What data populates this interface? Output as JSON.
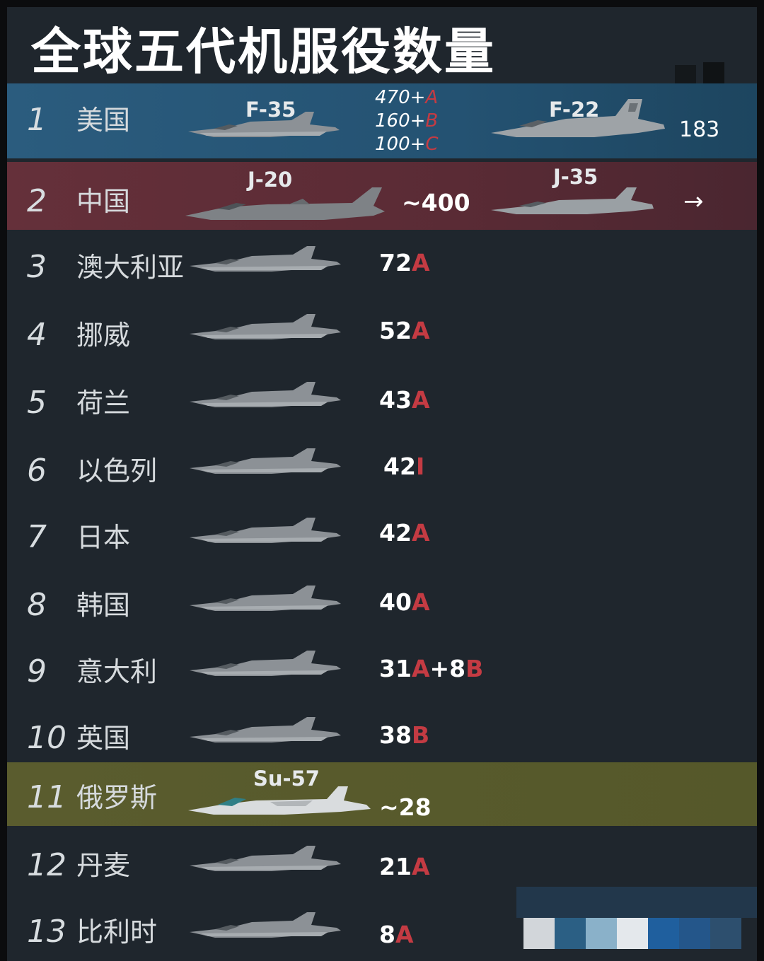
{
  "title": "全球五代机服役数量",
  "colors": {
    "background": "#1f262d",
    "usa_row": "#2b5c7e",
    "china_row": "#65303a",
    "russia_row": "#5a5c2e",
    "variant_letter": "#c43b43"
  },
  "chart_data": {
    "type": "table",
    "title": "全球五代机服役数量",
    "columns": [
      "rank",
      "country",
      "aircraft",
      "count"
    ],
    "rows": [
      {
        "rank": "1",
        "country": "美国",
        "aircraft": [
          {
            "model": "F-35",
            "variants": [
              {
                "n": "470+",
                "v": "A"
              },
              {
                "n": "160+",
                "v": "B"
              },
              {
                "n": "100+",
                "v": "C"
              }
            ]
          },
          {
            "model": "F-22",
            "count": "183"
          }
        ]
      },
      {
        "rank": "2",
        "country": "中国",
        "aircraft": [
          {
            "model": "J-20",
            "count": "~400"
          },
          {
            "model": "J-35",
            "count": "→"
          }
        ]
      },
      {
        "rank": "3",
        "country": "澳大利亚",
        "count": [
          {
            "n": "72",
            "v": "A"
          }
        ]
      },
      {
        "rank": "4",
        "country": "挪威",
        "count": [
          {
            "n": "52",
            "v": "A"
          }
        ]
      },
      {
        "rank": "5",
        "country": "荷兰",
        "count": [
          {
            "n": "43",
            "v": "A"
          }
        ]
      },
      {
        "rank": "6",
        "country": "以色列",
        "count": [
          {
            "n": "42",
            "v": "I"
          }
        ]
      },
      {
        "rank": "7",
        "country": "日本",
        "count": [
          {
            "n": "42",
            "v": "A"
          }
        ]
      },
      {
        "rank": "8",
        "country": "韩国",
        "count": [
          {
            "n": "40",
            "v": "A"
          }
        ]
      },
      {
        "rank": "9",
        "country": "意大利",
        "count": [
          {
            "n": "31",
            "v": "A"
          },
          {
            "n": "+8",
            "v": "B"
          }
        ]
      },
      {
        "rank": "10",
        "country": "英国",
        "count": [
          {
            "n": "38",
            "v": "B"
          }
        ]
      },
      {
        "rank": "11",
        "country": "俄罗斯",
        "aircraft": [
          {
            "model": "Su-57",
            "count": "~28"
          }
        ]
      },
      {
        "rank": "12",
        "country": "丹麦",
        "count": [
          {
            "n": "21",
            "v": "A"
          }
        ]
      },
      {
        "rank": "13",
        "country": "比利时",
        "count": [
          {
            "n": "8",
            "v": "A"
          }
        ]
      }
    ]
  },
  "rows": [
    {
      "rank": "1",
      "country": "美国",
      "jet1": "F-35",
      "jet2": "F-22",
      "stack": [
        {
          "n": "470+",
          "v": "A"
        },
        {
          "n": "160+",
          "v": "B"
        },
        {
          "n": "100+",
          "v": "C"
        }
      ],
      "f22_count": "183"
    },
    {
      "rank": "2",
      "country": "中国",
      "jet1": "J-20",
      "jet2": "J-35",
      "j20_count": "~400",
      "arrow": "→"
    },
    {
      "rank": "3",
      "country": "澳大利亚",
      "n": "72",
      "v": "A"
    },
    {
      "rank": "4",
      "country": "挪威",
      "n": "52",
      "v": "A"
    },
    {
      "rank": "5",
      "country": "荷兰",
      "n": "43",
      "v": "A"
    },
    {
      "rank": "6",
      "country": "以色列",
      "n": "42",
      "v": "I"
    },
    {
      "rank": "7",
      "country": "日本",
      "n": "42",
      "v": "A"
    },
    {
      "rank": "8",
      "country": "韩国",
      "n": "40",
      "v": "A"
    },
    {
      "rank": "9",
      "country": "意大利",
      "n": "31",
      "v": "A",
      "n2": "8",
      "v2": "B",
      "plus": "+"
    },
    {
      "rank": "10",
      "country": "英国",
      "n": "38",
      "v": "B"
    },
    {
      "rank": "11",
      "country": "俄罗斯",
      "jet1": "Su-57",
      "count": "~28"
    },
    {
      "rank": "12",
      "country": "丹麦",
      "n": "21",
      "v": "A"
    },
    {
      "rank": "13",
      "country": "比利时",
      "n": "8",
      "v": "A"
    }
  ]
}
